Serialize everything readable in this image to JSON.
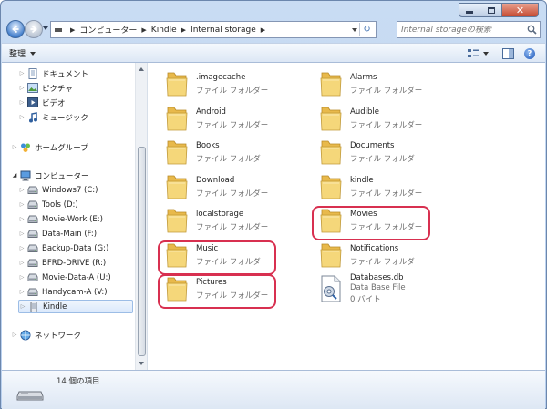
{
  "address": {
    "breadcrumbs": [
      "コンピューター",
      "Kindle",
      "Internal storage"
    ]
  },
  "search": {
    "placeholder": "Internal storageの検索"
  },
  "toolbar": {
    "organize_label": "整理"
  },
  "navpane": {
    "items": [
      {
        "label": "ドキュメント",
        "icon": "documents-icon",
        "level": 1
      },
      {
        "label": "ピクチャ",
        "icon": "pictures-icon",
        "level": 1
      },
      {
        "label": "ビデオ",
        "icon": "videos-icon",
        "level": 1
      },
      {
        "label": "ミュージック",
        "icon": "music-icon",
        "level": 1
      },
      {
        "label": "ホームグループ",
        "icon": "homegroup-icon",
        "level": 0
      },
      {
        "label": "コンピューター",
        "icon": "computer-icon",
        "level": 0
      },
      {
        "label": "Windows7 (C:)",
        "icon": "drive-icon",
        "level": 1
      },
      {
        "label": "Tools (D:)",
        "icon": "drive-icon",
        "level": 1
      },
      {
        "label": "Movie-Work (E:)",
        "icon": "drive-icon",
        "level": 1
      },
      {
        "label": "Data-Main (F:)",
        "icon": "drive-icon",
        "level": 1
      },
      {
        "label": "Backup-Data (G:)",
        "icon": "drive-icon",
        "level": 1
      },
      {
        "label": "BFRD-DRIVE (R:)",
        "icon": "drive-icon",
        "level": 1
      },
      {
        "label": "Movie-Data-A (U:)",
        "icon": "drive-icon",
        "level": 1
      },
      {
        "label": "Handycam-A (V:)",
        "icon": "drive-icon",
        "level": 1
      },
      {
        "label": "Kindle",
        "icon": "device-icon",
        "level": 1,
        "selected": true
      },
      {
        "label": "ネットワーク",
        "icon": "network-icon",
        "level": 0
      }
    ]
  },
  "files": [
    {
      "name": ".imagecache",
      "type": "ファイル フォルダー",
      "kind": "folder"
    },
    {
      "name": "Alarms",
      "type": "ファイル フォルダー",
      "kind": "folder"
    },
    {
      "name": "Android",
      "type": "ファイル フォルダー",
      "kind": "folder"
    },
    {
      "name": "Audible",
      "type": "ファイル フォルダー",
      "kind": "folder"
    },
    {
      "name": "Books",
      "type": "ファイル フォルダー",
      "kind": "folder"
    },
    {
      "name": "Documents",
      "type": "ファイル フォルダー",
      "kind": "folder"
    },
    {
      "name": "Download",
      "type": "ファイル フォルダー",
      "kind": "folder"
    },
    {
      "name": "kindle",
      "type": "ファイル フォルダー",
      "kind": "folder"
    },
    {
      "name": "localstorage",
      "type": "ファイル フォルダー",
      "kind": "folder"
    },
    {
      "name": "Movies",
      "type": "ファイル フォルダー",
      "kind": "folder",
      "highlighted": true
    },
    {
      "name": "Music",
      "type": "ファイル フォルダー",
      "kind": "folder",
      "highlighted": true
    },
    {
      "name": "Notifications",
      "type": "ファイル フォルダー",
      "kind": "folder"
    },
    {
      "name": "Pictures",
      "type": "ファイル フォルダー",
      "kind": "folder",
      "highlighted": true
    },
    {
      "name": "Databases.db",
      "type": "Data Base File",
      "size": "0 バイト",
      "kind": "file"
    }
  ],
  "status": {
    "item_count": "14 個の項目"
  },
  "colors": {
    "highlight": "#d83050",
    "folder": "#f2cf6a",
    "selection": "#dae8fb"
  }
}
